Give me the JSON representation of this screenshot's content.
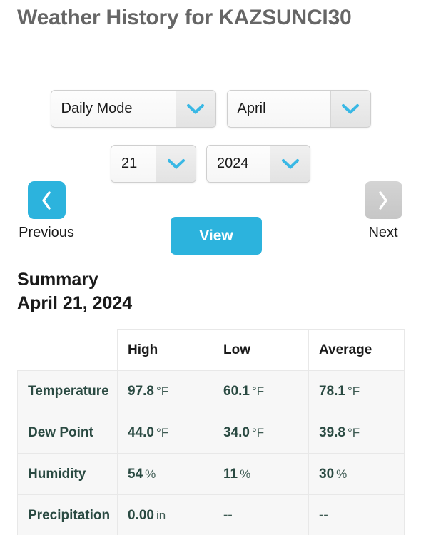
{
  "header": {
    "title": "Weather History for KAZSUNCI30"
  },
  "controls": {
    "mode_select": {
      "name": "mode-select",
      "value": "Daily Mode",
      "chevron": "chevron-down-icon"
    },
    "month_select": {
      "name": "month-select",
      "value": "April",
      "chevron": "chevron-down-icon"
    },
    "day_select": {
      "name": "day-select",
      "value": "21",
      "chevron": "chevron-down-icon"
    },
    "year_select": {
      "name": "year-select",
      "value": "2024",
      "chevron": "chevron-down-icon"
    }
  },
  "navigation": {
    "previous": {
      "label": "Previous",
      "icon": "chevron-left-icon",
      "enabled": true
    },
    "next": {
      "label": "Next",
      "icon": "chevron-right-icon",
      "enabled": false
    },
    "view_button": {
      "label": "View"
    }
  },
  "summary": {
    "heading": "Summary",
    "date": "April 21, 2024",
    "columns": [
      "",
      "High",
      "Low",
      "Average"
    ],
    "rows": [
      {
        "label": "Temperature",
        "high": {
          "value": "97.8",
          "unit": "°F"
        },
        "low": {
          "value": "60.1",
          "unit": "°F"
        },
        "average": {
          "value": "78.1",
          "unit": "°F"
        }
      },
      {
        "label": "Dew Point",
        "high": {
          "value": "44.0",
          "unit": "°F"
        },
        "low": {
          "value": "34.0",
          "unit": "°F"
        },
        "average": {
          "value": "39.8",
          "unit": "°F"
        }
      },
      {
        "label": "Humidity",
        "high": {
          "value": "54",
          "unit": "%"
        },
        "low": {
          "value": "11",
          "unit": "%"
        },
        "average": {
          "value": "30",
          "unit": "%"
        }
      },
      {
        "label": "Precipitation",
        "high": {
          "value": "0.00",
          "unit": "in"
        },
        "low": {
          "value": "--",
          "unit": ""
        },
        "average": {
          "value": "--",
          "unit": ""
        }
      }
    ]
  },
  "colors": {
    "accent": "#2cb3dd",
    "title_gray": "#666666",
    "table_text": "#2a4a42",
    "disabled_gray": "#cccccc"
  }
}
